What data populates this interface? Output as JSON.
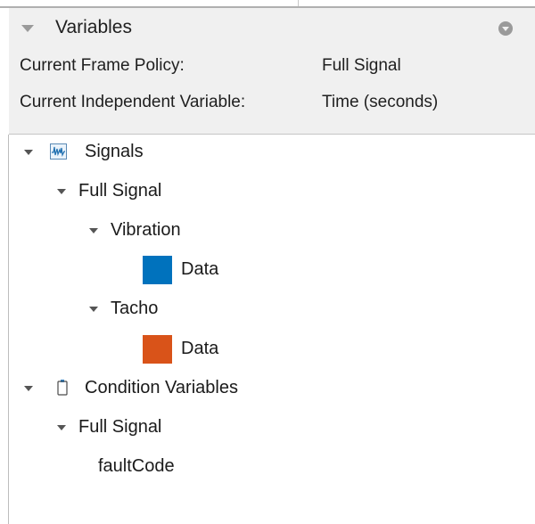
{
  "panel": {
    "title": "Variables"
  },
  "info": {
    "frame_policy_label": "Current Frame Policy:",
    "frame_policy_value": "Full Signal",
    "independent_variable_label": "Current Independent Variable:",
    "independent_variable_value": "Time (seconds)"
  },
  "tree": {
    "signals": "Signals",
    "signals_full_signal": "Full Signal",
    "vibration": "Vibration",
    "vibration_data": "Data",
    "tacho": "Tacho",
    "tacho_data": "Data",
    "condition_variables": "Condition Variables",
    "condition_full_signal": "Full Signal",
    "fault_code": "faultCode"
  },
  "colors": {
    "vibration_swatch": "#0072BD",
    "tacho_swatch": "#D95319",
    "header_background": "#f0f0f0"
  },
  "icons": {
    "signals": "signals-icon",
    "condition_variables": "condition-variables-icon",
    "expander": "chevron-down-icon",
    "panel_collapse": "collapse-triangle-icon",
    "panel_menu": "panel-menu-icon"
  }
}
